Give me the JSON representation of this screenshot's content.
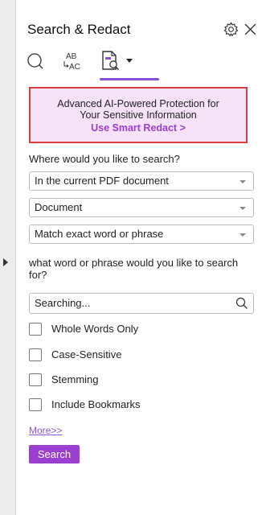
{
  "panel": {
    "title": "Search & Redact",
    "icons": [
      "gear-icon",
      "close-icon"
    ]
  },
  "toolbar": {
    "search_tool_icon": "search-icon",
    "replace_tool_label_top": "AB",
    "replace_tool_label_bottom": "AC",
    "redact_tool_icon": "document-search-icon",
    "active_tool": "redact",
    "accent": "#8a4fd8"
  },
  "promo": {
    "line1": "Advanced AI-Powered Protection for",
    "line2": "Your Sensitive Information",
    "link": "Use Smart Redact >",
    "background": "#f7e3f8",
    "border": "#d93d3d",
    "link_color": "#9b3fd1"
  },
  "where": {
    "question": "Where would you like to search?",
    "scope_value": "In the current PDF document",
    "target_value": "Document",
    "match_value": "Match exact word or phrase"
  },
  "phrase": {
    "question": "what word or phrase would you like to search for?",
    "input_value": "Searching..."
  },
  "options": [
    {
      "label": "Whole Words Only",
      "checked": false
    },
    {
      "label": "Case-Sensitive",
      "checked": false
    },
    {
      "label": "Stemming",
      "checked": false
    },
    {
      "label": "Include Bookmarks",
      "checked": false
    }
  ],
  "more_link": "More>>",
  "search_button": "Search"
}
